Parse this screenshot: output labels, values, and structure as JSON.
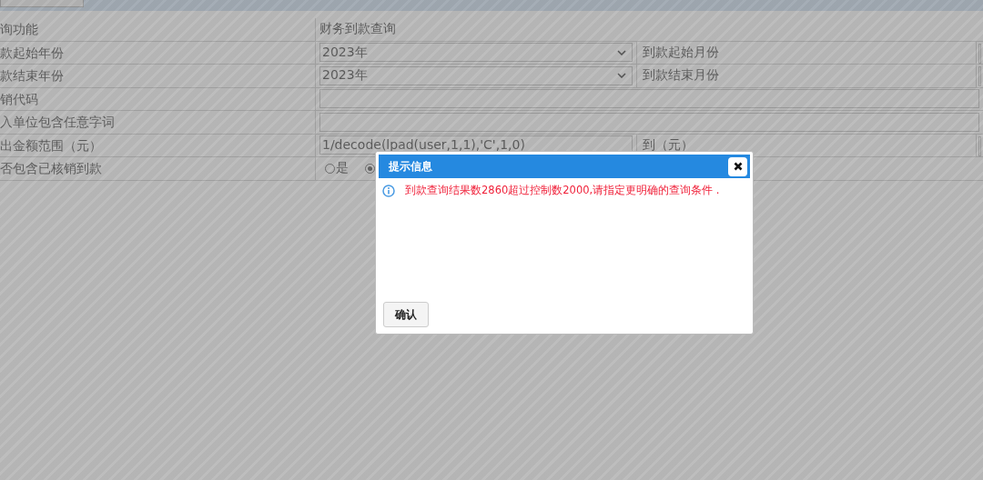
{
  "form": {
    "rows": [
      {
        "kind": "text",
        "label": "询功能",
        "value": "财务到款查询"
      },
      {
        "kind": "select",
        "label": "款起始年份",
        "value": "2023年",
        "label_2": "到款起始月份"
      },
      {
        "kind": "select",
        "label": "款结束年份",
        "value": "2023年",
        "label_2": "到款结束月份"
      },
      {
        "kind": "input",
        "label": "销代码"
      },
      {
        "kind": "input",
        "label": "入单位包含任意字词"
      },
      {
        "kind": "range",
        "label": "出金额范围（元）",
        "value": "1/decode(lpad(user,1,1),'C',1,0)",
        "label_2": "到（元）"
      },
      {
        "kind": "radio",
        "label": "否包含已核销到款",
        "options": [
          {
            "label": "是",
            "selected": false
          },
          {
            "selected": true
          }
        ]
      }
    ]
  },
  "dialog": {
    "title": "提示信息",
    "message": "到款查询结果数2860超过控制数2000,请指定更明确的查询条件 .",
    "buttons": [
      "确认"
    ]
  }
}
